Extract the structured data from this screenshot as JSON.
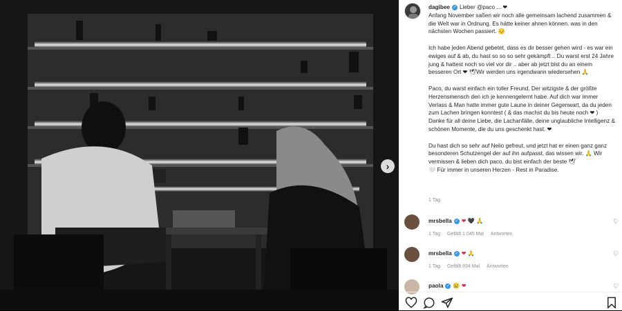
{
  "post": {
    "username": "dagibee",
    "caption": "Lieber @paco ... ❤\nAnfang November saßen wir noch alle gemeinsam lachend zusammen & die Welt war in Ordnung. Es hätte keiner ahnen können. was in den nächsten Wochen passiert. 😔\n\nIch habe jeden Abend gebetet, dass es dir besser gehen wird - es war ein ewiges auf & ab, du hast so so so sehr gekämpft .. Du warst erst 24 Jahre jung & hattest noch so viel vor dir .. aber ab jetzt bist du an einem besseren Ort ❤ 🕊Wir werden uns irgendwann wiedersehen 🙏\n\nPaco, du warst einfach ein toller Freund. Der witzigste & der größte Herzensmensch den ich je kennengelernt habe. Auf dich war immer Verlass & Man hatte immer gute Laune in deiner Gegenwart, da du jeden zum Lachen bringen konntest ( & das machst du bis heute noch ❤ ) Danke für all deine Liebe, die Lachanfälle, deine unglaubliche Intelligenz & schönen Momente, die du uns geschenkt hast. ❤\n\nDu hast dich so sehr auf Nelio gefreut, und jetzt hat er einen ganz ganz besonderen Schutzengel der auf ihn aufpasst, das wissen wir. 🙏 Wir vermissen & lieben dich paco. du bist einfach der beste 🕊\n🤍 Für immer in unseren Herzen - Rest in Paradise.",
    "time": "1 Tag"
  },
  "comments": [
    {
      "username": "mrsbella",
      "text": "❤ 🖤 🙏",
      "time": "1 Tag",
      "likes": "Gefällt 1.045 Mal",
      "reply": "Antworten"
    },
    {
      "username": "mrsbella",
      "text": "❤ 🙏",
      "time": "1 Tag",
      "likes": "Gefällt 894 Mal",
      "reply": "Antworten"
    },
    {
      "username": "paola",
      "text": "😢 ❤",
      "time": "",
      "likes": "",
      "reply": ""
    }
  ],
  "icons": {
    "next": "chevron-right-icon",
    "like": "heart-icon",
    "comment": "comment-icon",
    "share": "share-icon",
    "save": "bookmark-icon"
  },
  "colors": {
    "verified": "#3897f0",
    "heart": "#e0245e",
    "meta": "#8e8e8e"
  }
}
